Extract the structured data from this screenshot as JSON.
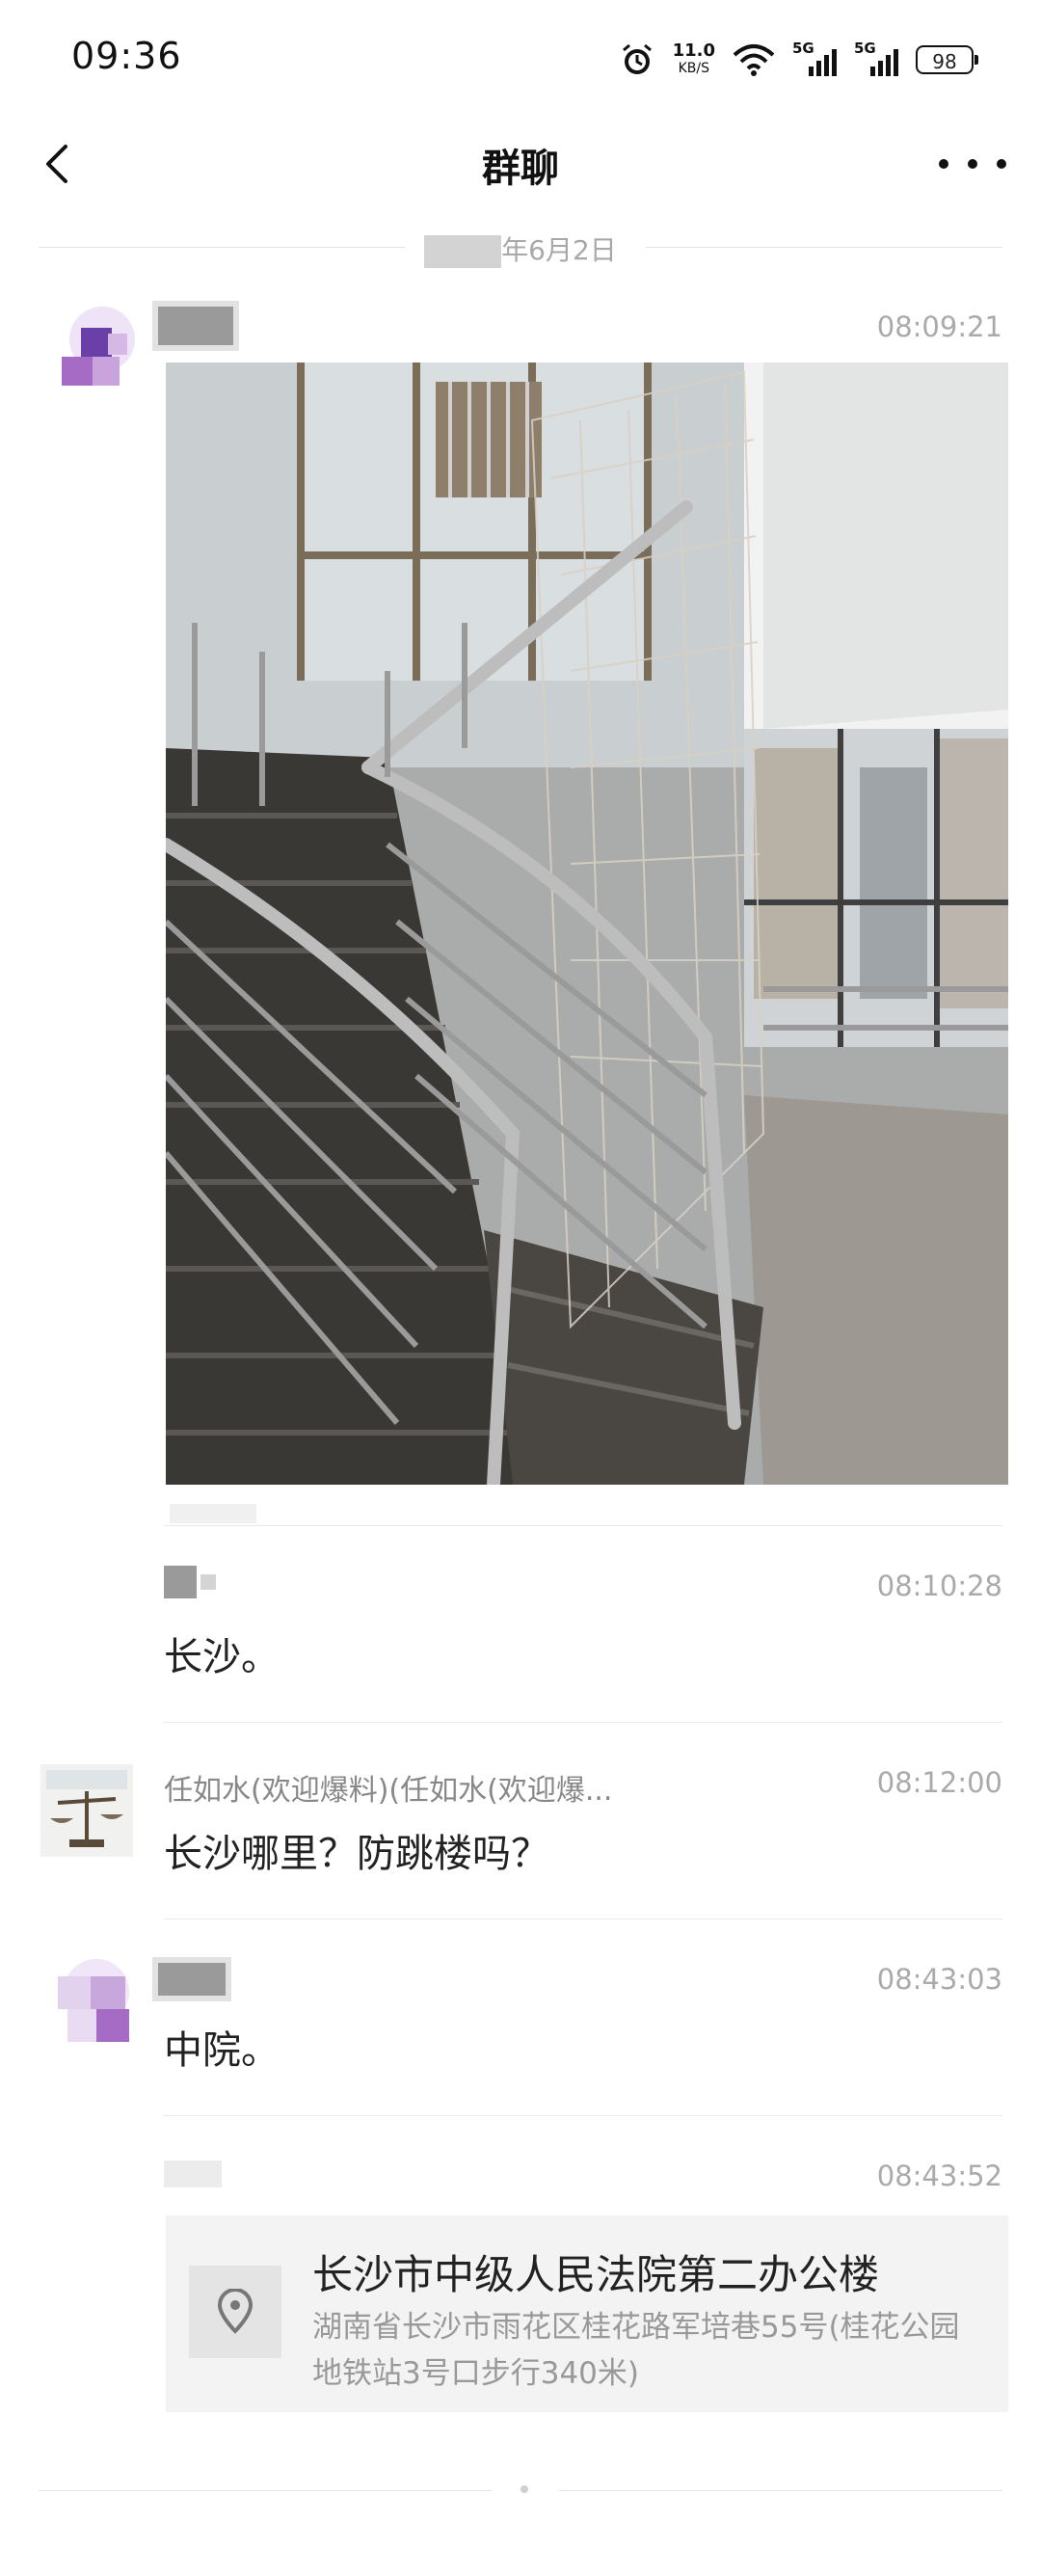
{
  "status": {
    "time": "09:36",
    "speed_value": "11.0",
    "speed_unit": "KB/S",
    "sig1_label": "5G",
    "sig2_label": "5G",
    "battery": "98"
  },
  "nav": {
    "title": "群聊"
  },
  "date_divider": "年6月2日",
  "messages": [
    {
      "time": "08:09:21",
      "type": "image"
    },
    {
      "time": "08:10:28",
      "text": "长沙。"
    },
    {
      "sender": "任如水(欢迎爆料)(任如水(欢迎爆...",
      "time": "08:12:00",
      "text": "长沙哪里？防跳楼吗？"
    },
    {
      "time": "08:43:03",
      "text": "中院。"
    },
    {
      "time": "08:43:52",
      "location": {
        "title": "长沙市中级人民法院第二办公楼",
        "address": "湖南省长沙市雨花区桂花路军培巷55号(桂花公园地铁站3号口步行340米)"
      }
    }
  ],
  "colors": {
    "accent_text": "#222222",
    "muted_text": "#aaaaaa",
    "avatar_purple": "#8e5bc4"
  },
  "icons": [
    "back-icon",
    "more-icon",
    "alarm-icon",
    "wifi-icon",
    "signal-icon",
    "battery-icon",
    "location-pin-icon"
  ]
}
